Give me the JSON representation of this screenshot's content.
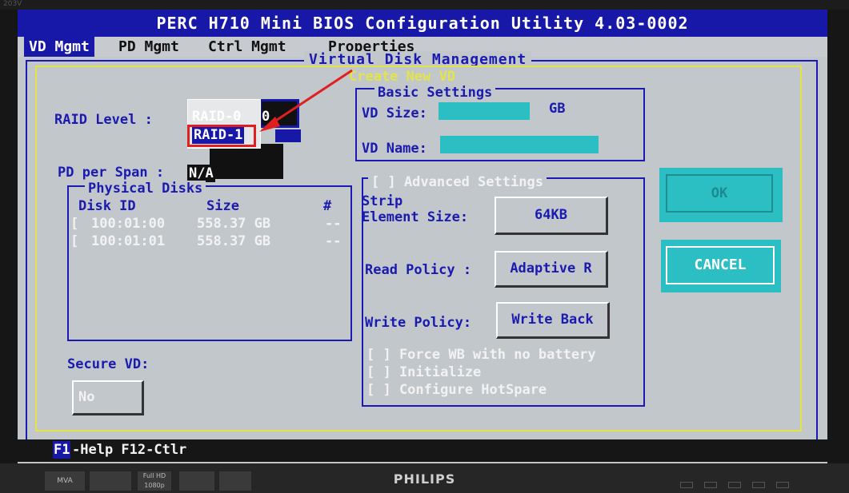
{
  "monitor": {
    "model_tag": "203V",
    "brand": "PHILIPS",
    "badges": [
      "MVA",
      "",
      "Full HD 1080p",
      "",
      ""
    ]
  },
  "bios": {
    "title": "PERC H710 Mini BIOS Configuration Utility 4.03-0002",
    "menu": [
      {
        "label": "VD Mgmt",
        "active": true
      },
      {
        "label": "PD Mgmt",
        "active": false
      },
      {
        "label": "Ctrl Mgmt",
        "active": false
      },
      {
        "label": "Properties",
        "active": false
      }
    ],
    "panel_title": "Virtual Disk Management",
    "dialog_title": "Create New VD",
    "raid_level": {
      "label": "RAID Level :",
      "options": [
        "RAID-0",
        "RAID-1"
      ],
      "field_value": "0"
    },
    "pd_per_span": {
      "label": "PD per Span :",
      "value": "N/A"
    },
    "physical_disks": {
      "title": "Physical Disks",
      "columns": [
        "Disk ID",
        "Size",
        "#"
      ],
      "rows": [
        {
          "check": "[",
          "id": "100:01:00",
          "size": "558.37 GB",
          "num": "--"
        },
        {
          "check": "[",
          "id": "100:01:01",
          "size": "558.37 GB",
          "num": "--"
        }
      ]
    },
    "secure_vd": {
      "label": "Secure VD:",
      "value": "No"
    },
    "basic_settings": {
      "title": "Basic Settings",
      "vd_size_label": "VD Size:",
      "vd_size_value": "",
      "vd_size_unit": "GB",
      "vd_name_label": "VD Name:",
      "vd_name_value": ""
    },
    "advanced_settings": {
      "title": "[ ] Advanced Settings",
      "strip_label_1": "Strip",
      "strip_label_2": "Element Size:",
      "strip_value": "64KB",
      "read_label": "Read Policy :",
      "read_value": "Adaptive R",
      "write_label": "Write Policy:",
      "write_value": "Write Back",
      "checkboxes": [
        "[ ] Force WB with no battery",
        "[ ] Initialize",
        "[ ] Configure HotSpare"
      ]
    },
    "buttons": {
      "ok": "OK",
      "cancel": "CANCEL"
    },
    "help": {
      "key": "F1",
      "text": "-Help F12-Ctlr"
    },
    "colors": {
      "title_bar": "#1818a8",
      "cyan": "#2bbfc4",
      "frame_blue": "#1a1ab0",
      "frame_yellow": "#e3e44a",
      "annotation_red": "#e02020"
    }
  }
}
